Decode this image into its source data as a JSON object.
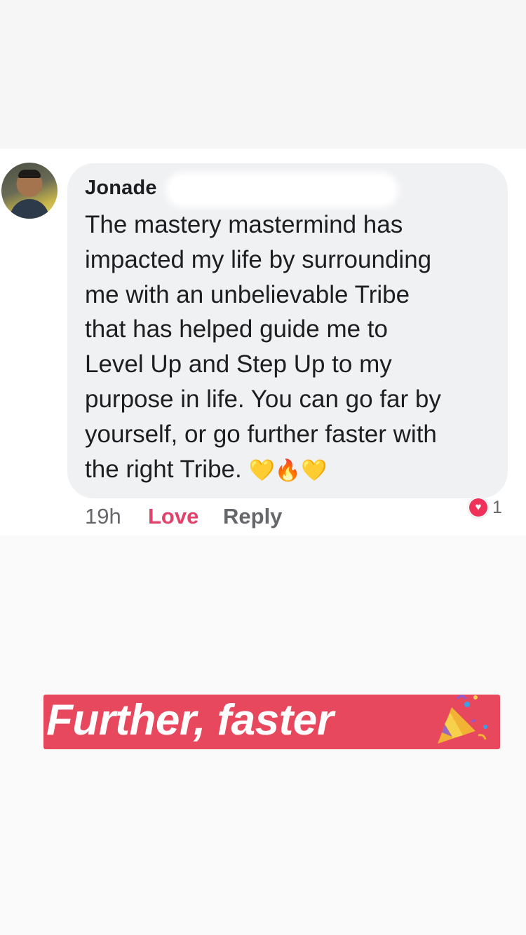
{
  "comment": {
    "author": "Jonade",
    "author_trailing": "",
    "lines": [
      "The mastery mastermind has",
      "impacted my life by surrounding",
      "me with an unbelievable Tribe",
      "that has helped guide me to",
      "Level Up and Step Up to my",
      "purpose in life. You can go far by",
      "yourself, or go further faster with"
    ],
    "last_line": "the right Tribe.",
    "emojis": [
      "💛",
      "🔥",
      "💛"
    ],
    "time": "19h",
    "love_label": "Love",
    "reply_label": "Reply",
    "reaction_count": "1"
  },
  "banner": {
    "text": "Further, faster"
  },
  "colors": {
    "love": "#e2416b",
    "banner": "#e8485e",
    "bubble": "#f0f1f3"
  },
  "icons": {
    "reaction": "heart-reaction-icon",
    "banner_decoration": "party-popper-icon"
  }
}
